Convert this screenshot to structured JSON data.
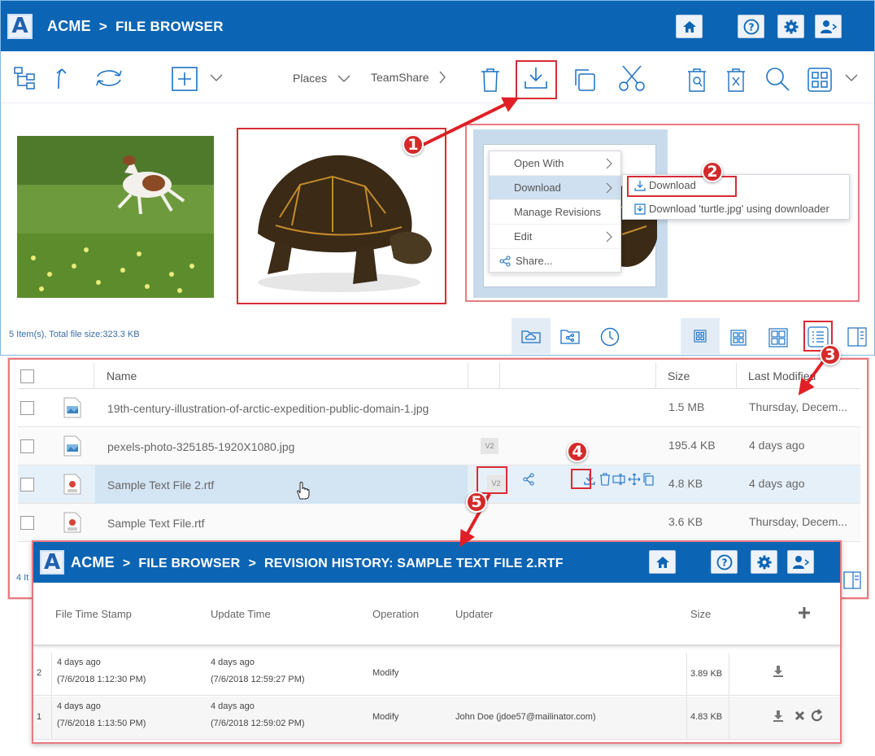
{
  "app": {
    "logo": "A",
    "brand": "ACME",
    "section": "FILE BROWSER",
    "sep": ">"
  },
  "toolbar": {
    "places_label": "Places",
    "teamshare_label": "TeamShare"
  },
  "context_menu": {
    "items": [
      "Open With",
      "Download",
      "Manage Revisions",
      "Edit",
      "Share..."
    ],
    "submenu": [
      "Download",
      "Download 'turtle.jpg' using downloader"
    ]
  },
  "status": {
    "summary": "5 Item(s), Total file size:323.3 KB",
    "summary_short": "4 It"
  },
  "file_list": {
    "headers": {
      "name": "Name",
      "size": "Size",
      "modified": "Last Modified"
    },
    "rows": [
      {
        "name": "19th-century-illustration-of-arctic-expedition-public-domain-1.jpg",
        "size": "1.5 MB",
        "modified": "Thursday, Decem...",
        "version": ""
      },
      {
        "name": "pexels-photo-325185-1920X1080.jpg",
        "size": "195.4 KB",
        "modified": "4 days ago",
        "version": "V2"
      },
      {
        "name": "Sample Text File 2.rtf",
        "size": "4.8 KB",
        "modified": "4 days ago",
        "version": "V2"
      },
      {
        "name": "Sample Text File.rtf",
        "size": "3.6 KB",
        "modified": "Thursday, Decem...",
        "version": ""
      }
    ]
  },
  "revision": {
    "brand": "ACME",
    "section": "FILE BROWSER",
    "title": "REVISION HISTORY: SAMPLE TEXT FILE 2.RTF",
    "headers": {
      "stamp": "File Time Stamp",
      "update": "Update Time",
      "operation": "Operation",
      "updater": "Updater",
      "size": "Size"
    },
    "rows": [
      {
        "num": "2",
        "stamp_rel": "4 days ago",
        "stamp_abs": "(7/6/2018 1:12:30 PM)",
        "update_rel": "4 days ago",
        "update_abs": "(7/6/2018 12:59:27 PM)",
        "operation": "Modify",
        "updater": "",
        "size": "3.89 KB"
      },
      {
        "num": "1",
        "stamp_rel": "4 days ago",
        "stamp_abs": "(7/6/2018 1:13:50 PM)",
        "update_rel": "4 days ago",
        "update_abs": "(7/6/2018 12:59:02 PM)",
        "operation": "Modify",
        "updater": "John Doe (jdoe57@mailinator.com)",
        "size": "4.83 KB"
      }
    ]
  },
  "callouts": [
    "1",
    "2",
    "3",
    "4",
    "5"
  ],
  "colors": {
    "header_blue": "#0c65b4",
    "callout_red": "#d42a2a",
    "highlight_row": "#dbe9f5"
  }
}
